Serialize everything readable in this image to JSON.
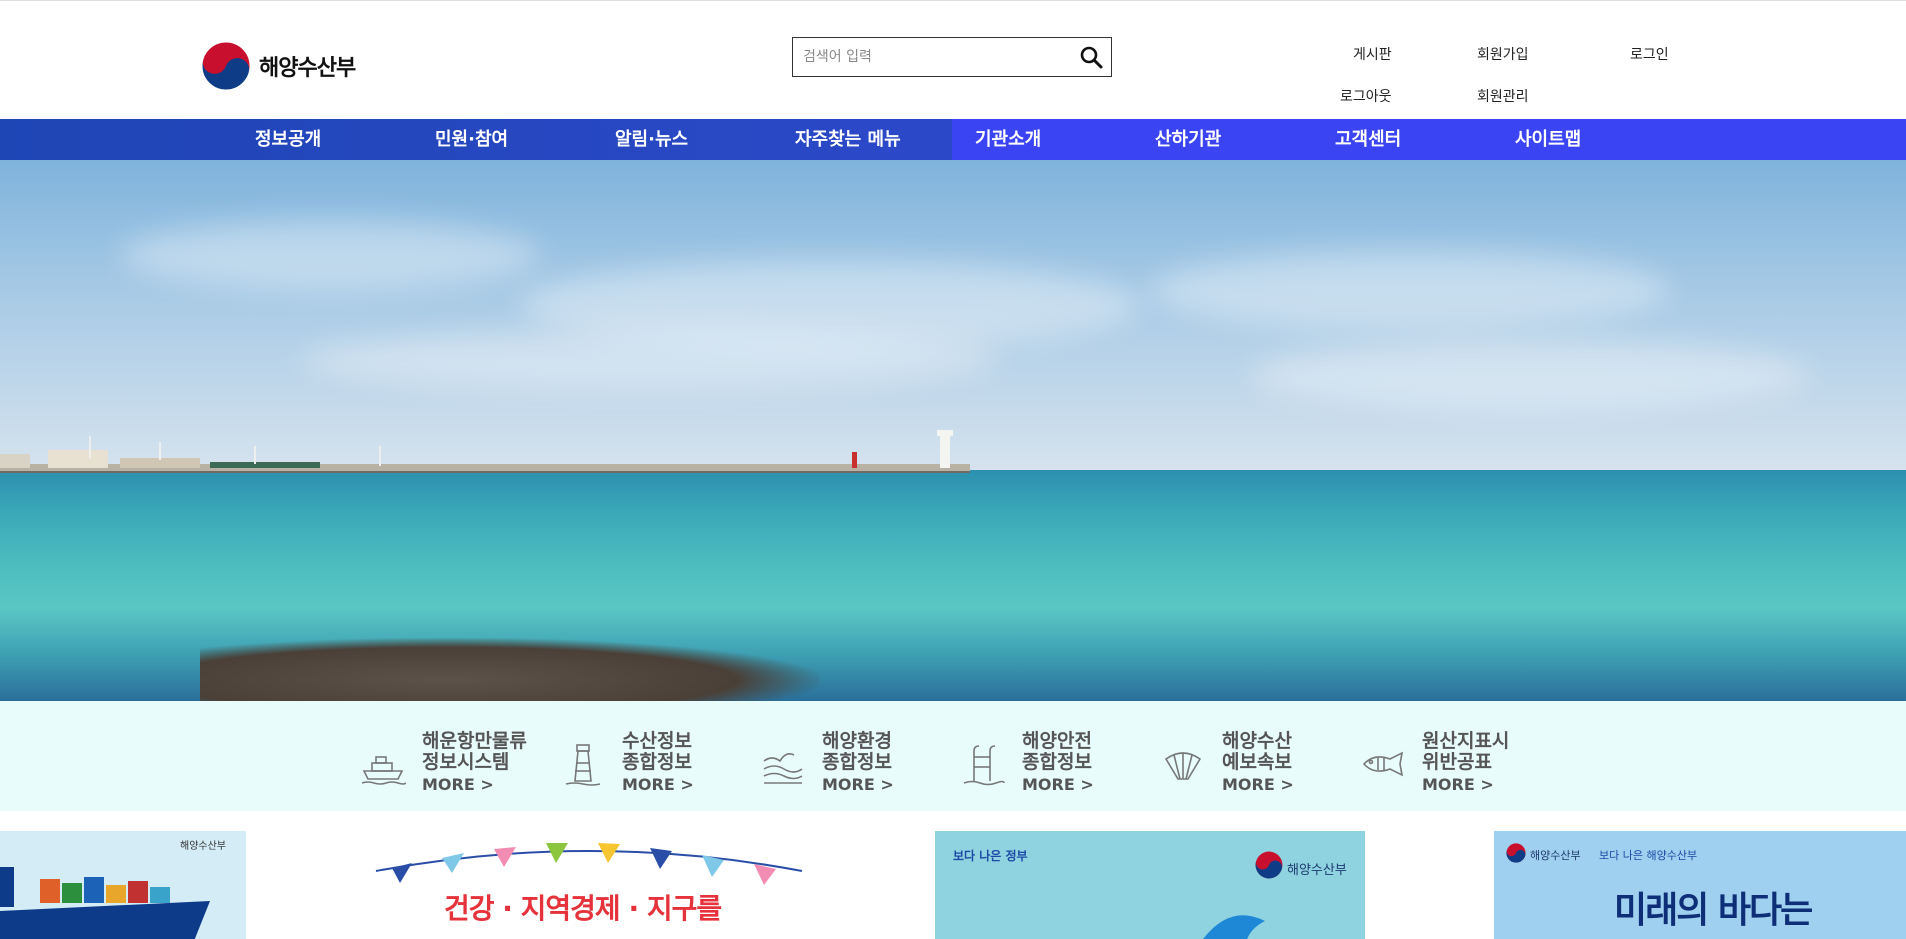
{
  "brand": {
    "name": "해양수산부"
  },
  "search": {
    "placeholder": "검색어 입력"
  },
  "utility_links": {
    "board": "게시판",
    "signup": "회원가입",
    "login": "로그인",
    "logout": "로그아웃",
    "member_admin": "회원관리"
  },
  "nav": {
    "items": [
      "정보공개",
      "민원·참여",
      "알림·뉴스",
      "자주찾는 메뉴",
      "기관소개",
      "산하기관",
      "고객센터",
      "사이트맵"
    ]
  },
  "quick_links": [
    {
      "title": "해운항만물류\n정보시스템",
      "more": "MORE >",
      "icon": "ship-icon"
    },
    {
      "title": "수산정보\n종합정보",
      "more": "MORE >",
      "icon": "lighthouse-icon"
    },
    {
      "title": "해양환경\n종합정보",
      "more": "MORE >",
      "icon": "wave-icon"
    },
    {
      "title": "해양안전\n종합정보",
      "more": "MORE >",
      "icon": "ladder-icon"
    },
    {
      "title": "해양수산\n예보속보",
      "more": "MORE >",
      "icon": "shell-icon"
    },
    {
      "title": "원산지표시\n위반공표",
      "more": "MORE >",
      "icon": "fish-icon"
    }
  ],
  "banners": {
    "b1_brand": "해양수산부",
    "b2_headline": "건강 · 지역경제 · 지구를",
    "b3_tag": "보다 나은 정부",
    "b3_brand": "해양수산부",
    "b4_brand": "해양수산부",
    "b4_tag": "보다 나은 해양수산부",
    "b4_headline": "미래의 바다는"
  },
  "colors": {
    "nav": "#2b48c9",
    "nav_active": "#3a44f2",
    "quick_bg": "#e9fcfc"
  }
}
